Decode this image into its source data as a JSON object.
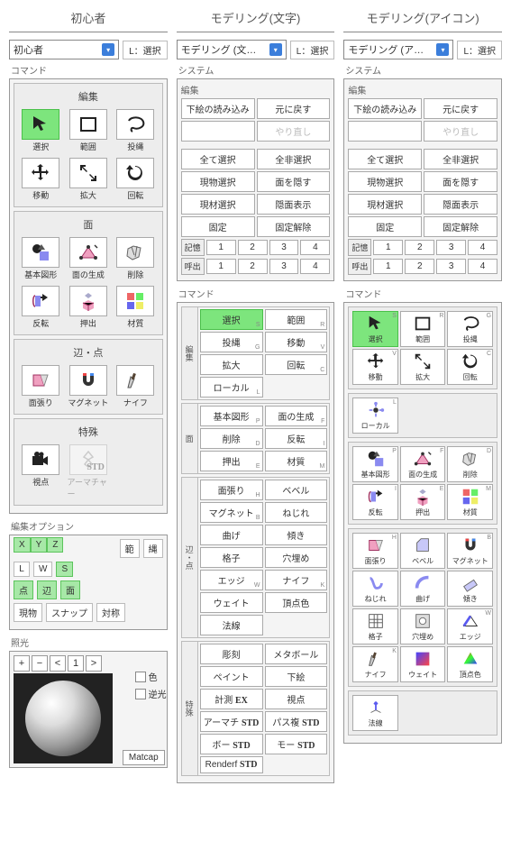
{
  "columns": [
    {
      "name": "beginner",
      "title": "初心者"
    },
    {
      "name": "modeling-text",
      "title": "モデリング(文字)"
    },
    {
      "name": "modeling-icon",
      "title": "モデリング(アイコン)"
    }
  ],
  "beginner": {
    "dropdown": "初心者",
    "mode_label": "L：選択",
    "section_command": "コマンド",
    "edit_title": "編集",
    "edit_items": [
      {
        "k": "select",
        "label": "選択",
        "sel": true,
        "icon": "cursor"
      },
      {
        "k": "range",
        "label": "範囲",
        "icon": "rect"
      },
      {
        "k": "lasso",
        "label": "投縄",
        "icon": "lasso"
      },
      {
        "k": "move",
        "label": "移動",
        "icon": "move"
      },
      {
        "k": "scale",
        "label": "拡大",
        "icon": "scale"
      },
      {
        "k": "rotate",
        "label": "回転",
        "icon": "rotate"
      }
    ],
    "face_title": "面",
    "face_items": [
      {
        "k": "primitive",
        "label": "基本図形",
        "icon": "primitive"
      },
      {
        "k": "mkface",
        "label": "面の生成",
        "icon": "mkface"
      },
      {
        "k": "delete",
        "label": "削除",
        "icon": "crumble"
      },
      {
        "k": "flip",
        "label": "反転",
        "icon": "flip"
      },
      {
        "k": "extrude",
        "label": "押出",
        "icon": "extrude"
      },
      {
        "k": "material",
        "label": "材質",
        "icon": "material"
      }
    ],
    "edgevert_title": "辺・点",
    "edgevert_items": [
      {
        "k": "stretch",
        "label": "面張り",
        "icon": "stretch"
      },
      {
        "k": "magnet",
        "label": "マグネット",
        "icon": "magnet"
      },
      {
        "k": "knife",
        "label": "ナイフ",
        "icon": "knife"
      }
    ],
    "special_title": "特殊",
    "special_items": [
      {
        "k": "view",
        "label": "視点",
        "icon": "camera"
      },
      {
        "k": "armature",
        "label": "アーマチャー",
        "icon": "armature",
        "disabled": true
      }
    ],
    "editopt_title": "編集オプション",
    "axes": [
      "X",
      "Y",
      "Z"
    ],
    "lws": [
      "L",
      "W",
      "S"
    ],
    "range_label": "範",
    "rope_label": "縄",
    "pef": [
      "点",
      "辺",
      "面"
    ],
    "current": "現物",
    "snap": "スナップ",
    "symmetry": "対称",
    "light_title": "照光",
    "matcap_controls": [
      "+",
      "−",
      "<",
      "1",
      ">"
    ],
    "col_label": "色",
    "back_label": "逆光",
    "matcap_btn": "Matcap"
  },
  "mtext": {
    "dropdown": "モデリング (文…",
    "mode_label": "L：選択",
    "sys_title": "システム",
    "edit_title": "編集",
    "load_sketch": "下絵の読み込み",
    "undo": "元に戻す",
    "redo": "やり直し",
    "sel_all": "全て選択",
    "desel_all": "全非選択",
    "sel_visible": "現物選択",
    "hide_face": "面を隠す",
    "sel_material": "現材選択",
    "show_hidden": "隠面表示",
    "fix": "固定",
    "unfix": "固定解除",
    "store": "記憶",
    "recall": "呼出",
    "slots": [
      "1",
      "2",
      "3",
      "4"
    ],
    "command_title": "コマンド",
    "groups": {
      "edit": {
        "title": "編集",
        "items": [
          {
            "label": "選択",
            "sub": "S",
            "sel": true
          },
          {
            "label": "範囲",
            "sub": "R"
          },
          {
            "label": "投縄",
            "sub": "G"
          },
          {
            "label": "移動",
            "sub": "V"
          },
          {
            "label": "拡大",
            "sub": ""
          },
          {
            "label": "回転",
            "sub": "C"
          },
          {
            "label": "ローカル",
            "sub": "L",
            "span": 1
          }
        ]
      },
      "face": {
        "title": "面",
        "items": [
          {
            "label": "基本図形",
            "sub": "P"
          },
          {
            "label": "面の生成",
            "sub": "F"
          },
          {
            "label": "削除",
            "sub": "D"
          },
          {
            "label": "反転",
            "sub": "I"
          },
          {
            "label": "押出",
            "sub": "E"
          },
          {
            "label": "材質",
            "sub": "M"
          }
        ]
      },
      "edgevert": {
        "title": "辺・点",
        "items": [
          {
            "label": "面張り",
            "sub": "H"
          },
          {
            "label": "ベベル",
            "sub": ""
          },
          {
            "label": "マグネット",
            "sub": "B"
          },
          {
            "label": "ねじれ",
            "sub": ""
          },
          {
            "label": "曲げ",
            "sub": ""
          },
          {
            "label": "傾き",
            "sub": ""
          },
          {
            "label": "格子",
            "sub": ""
          },
          {
            "label": "穴埋め",
            "sub": ""
          },
          {
            "label": "エッジ",
            "sub": "W"
          },
          {
            "label": "ナイフ",
            "sub": "K"
          },
          {
            "label": "ウェイト",
            "sub": ""
          },
          {
            "label": "頂点色",
            "sub": ""
          },
          {
            "label": "法線",
            "sub": "",
            "span": 1
          }
        ]
      },
      "special": {
        "title": "特殊",
        "items": [
          {
            "label": "彫刻",
            "sub": ""
          },
          {
            "label": "メタボール",
            "sub": ""
          },
          {
            "label": "ペイント",
            "sub": ""
          },
          {
            "label": "下絵",
            "sub": ""
          },
          {
            "label": "計測",
            "sub": "",
            "ex": true
          },
          {
            "label": "視点",
            "sub": ""
          },
          {
            "label": "アーマチ",
            "sub": "",
            "std": true
          },
          {
            "label": "パス複",
            "sub": "",
            "std": true
          },
          {
            "label": "ボー",
            "sub": "",
            "std": true
          },
          {
            "label": "モー",
            "sub": "",
            "std": true
          },
          {
            "label": "Renderf",
            "sub": "",
            "std": true,
            "span": 1
          }
        ]
      }
    }
  },
  "micon": {
    "dropdown": "モデリング (ア…",
    "mode_label": "L：選択",
    "sys_title": "システム",
    "labels": {
      "select": "選択",
      "range": "範囲",
      "lasso": "投縄",
      "move": "移動",
      "scale": "拡大",
      "rotate": "回転",
      "local": "ローカル",
      "primitive": "基本図形",
      "mkface": "面の生成",
      "delete": "削除",
      "flip": "反転",
      "extrude": "押出",
      "material": "材質",
      "stretch": "面張り",
      "bevel": "ベベル",
      "magnet": "マグネット",
      "twist": "ねじれ",
      "bend": "曲げ",
      "tilt": "傾き",
      "lattice": "格子",
      "fill": "穴埋め",
      "edge": "エッジ",
      "knife": "ナイフ",
      "weight": "ウェイト",
      "vcolor": "頂点色",
      "normal": "法線"
    },
    "badges": {
      "select": "S",
      "range": "R",
      "lasso": "G",
      "move": "V",
      "scale": "",
      "rotate": "C",
      "local": "L",
      "primitive": "P",
      "mkface": "F",
      "delete": "D",
      "flip": "I",
      "extrude": "E",
      "material": "M",
      "stretch": "H",
      "bevel": "",
      "magnet": "B",
      "edge": "W",
      "knife": "K"
    }
  }
}
